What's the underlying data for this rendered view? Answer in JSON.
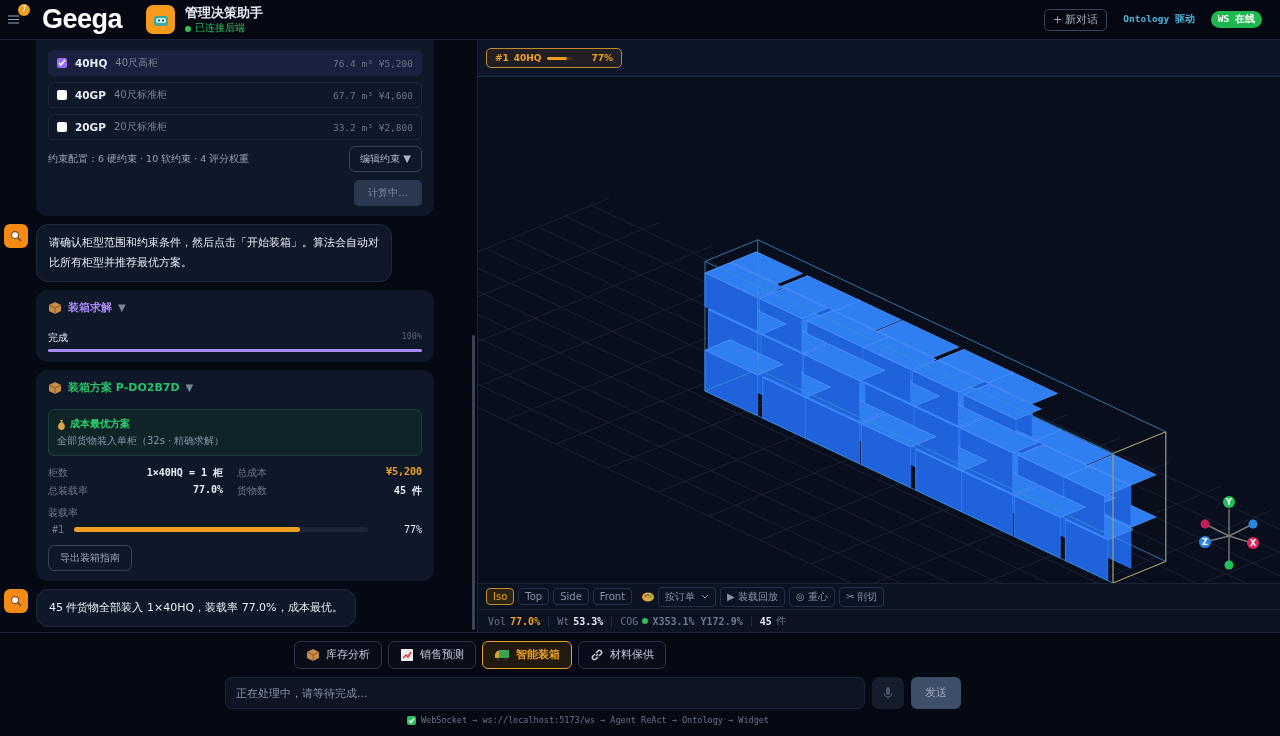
{
  "header": {
    "menu_badge": "7",
    "logo": "Geega",
    "app_title": "管理决策助手",
    "connection": "已连接后端",
    "new_chat": "+ 新对话",
    "engine": "Ontology 驱动",
    "ws_status": "WS 在线"
  },
  "container_options": [
    {
      "code": "40HQ",
      "name": "40尺高柜",
      "spec": "76.4 m³ ¥5,200",
      "checked": true
    },
    {
      "code": "40GP",
      "name": "40尺标准柜",
      "spec": "67.7 m³ ¥4,600",
      "checked": false
    },
    {
      "code": "20GP",
      "name": "20尺标准柜",
      "spec": "33.2 m³ ¥2,800",
      "checked": false
    }
  ],
  "constraints": {
    "summary": "约束配置：6 硬约束 · 10 软约束 · 4 评分权重",
    "edit": "编辑约束 ▼",
    "compute": "计算中..."
  },
  "assistant_message_1": "请确认柜型范围和约束条件，然后点击「开始装箱」。算法会自动对比所有柜型并推荐最优方案。",
  "solve_card": {
    "title": "装箱求解",
    "caret": "▼",
    "status": "完成",
    "percent": "100%",
    "level": 1
  },
  "plan_card": {
    "title": "装箱方案 P-DO2B7D",
    "caret": "▼",
    "highlight_title": "成本最优方案",
    "highlight_note": "全部货物装入单柜（32s · 精确求解）",
    "stats": [
      {
        "label": "柜数",
        "value": "1×40HQ = 1 柜",
        "kind": "plain"
      },
      {
        "label": "总成本",
        "value": "¥5,200",
        "kind": "accent"
      },
      {
        "label": "总装载率",
        "value": "77.0%",
        "kind": "plain"
      },
      {
        "label": "货物数",
        "value": "45 件",
        "kind": "plain"
      }
    ],
    "rate_label": "装载率",
    "bars": [
      {
        "label": "#1",
        "percent": "77%",
        "level": 0.77
      }
    ],
    "export": "导出装箱指南"
  },
  "assistant_message_2": "45 件货物全部装入 1×40HQ，装载率 77.0%，成本最优。",
  "viewer": {
    "chip": {
      "index": "#1",
      "code": "40HQ",
      "percent": "77%",
      "level": 0.77
    },
    "views": [
      {
        "label": "Iso",
        "selected": true
      },
      {
        "label": "Top",
        "selected": false
      },
      {
        "label": "Side",
        "selected": false
      },
      {
        "label": "Front",
        "selected": false
      }
    ],
    "color_by": "按订单",
    "tools": [
      "▶ 装载回放",
      "◎ 重心",
      "✂ 剖切"
    ],
    "gizmo_axes": [
      "X",
      "Y",
      "Z"
    ],
    "stats": [
      {
        "label": "Vol",
        "value": "77.0%",
        "kind": "accent"
      },
      {
        "label": "Wt",
        "value": "53.3%",
        "kind": "plain"
      },
      {
        "label": "COG",
        "value": "X353.1% Y172.9%",
        "kind": "dot"
      },
      {
        "value": "45",
        "unit": "件",
        "kind": "count"
      }
    ]
  },
  "tabs": [
    {
      "label": "库存分析",
      "selected": false
    },
    {
      "label": "销售预测",
      "selected": false
    },
    {
      "label": "智能装箱",
      "selected": true
    },
    {
      "label": "材料保供",
      "selected": false
    }
  ],
  "input": {
    "placeholder": "正在处理中，请等待完成...",
    "send": "发送"
  },
  "footer": "WebSocket → ws://localhost:5173/ws → Agent ReAct → Ontology → Widget"
}
